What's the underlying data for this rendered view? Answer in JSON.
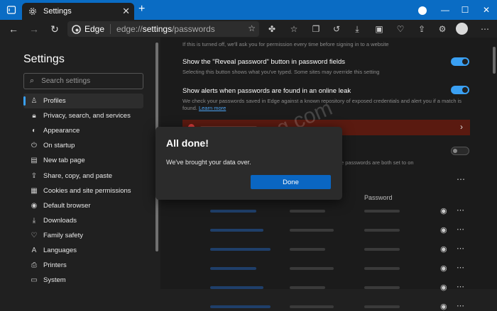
{
  "window": {
    "tab_title": "Settings",
    "new_tab_symbol": "+",
    "controls": {
      "minimize": "—",
      "maximize": "☐",
      "close": "✕"
    }
  },
  "toolbar": {
    "brand": "Edge",
    "url_prefix": "edge://",
    "url_host": "settings",
    "url_path": "/passwords"
  },
  "sidebar": {
    "title": "Settings",
    "search_placeholder": "Search settings",
    "items": [
      {
        "label": "Profiles",
        "icon": "profile-icon",
        "active": true
      },
      {
        "label": "Privacy, search, and services",
        "icon": "lock-icon"
      },
      {
        "label": "Appearance",
        "icon": "palette-icon"
      },
      {
        "label": "On startup",
        "icon": "power-icon"
      },
      {
        "label": "New tab page",
        "icon": "new-tab-icon"
      },
      {
        "label": "Share, copy, and paste",
        "icon": "share-icon"
      },
      {
        "label": "Cookies and site permissions",
        "icon": "permissions-icon"
      },
      {
        "label": "Default browser",
        "icon": "browser-icon"
      },
      {
        "label": "Downloads",
        "icon": "download-icon"
      },
      {
        "label": "Family safety",
        "icon": "family-icon"
      },
      {
        "label": "Languages",
        "icon": "language-icon"
      },
      {
        "label": "Printers",
        "icon": "printer-icon"
      },
      {
        "label": "System",
        "icon": "system-icon"
      }
    ]
  },
  "main": {
    "top_desc": "If this is turned off, we'll ask you for permission every time before signing in to a website",
    "reveal": {
      "heading": "Show the \"Reveal password\" button in password fields",
      "desc": "Selecting this button shows what you've typed. Some sites may override this setting",
      "enabled": true
    },
    "alerts": {
      "heading": "Show alerts when passwords are found in an online leak",
      "desc": "We check your passwords saved in Edge against a known repository of exposed credentials and alert you if a match is found.",
      "link": "Learn more",
      "enabled": true
    },
    "partial_desc": "e passwords are both set to on",
    "password_column": "Password"
  },
  "dialog": {
    "title": "All done!",
    "message": "We've brought your data over.",
    "button": "Done"
  },
  "watermark": "geekermag.com",
  "colors": {
    "accent": "#0a66c2",
    "titlebar": "#0a6cc4",
    "toggle_on": "#3aa0f3",
    "alert_bar": "#5a1a10"
  }
}
